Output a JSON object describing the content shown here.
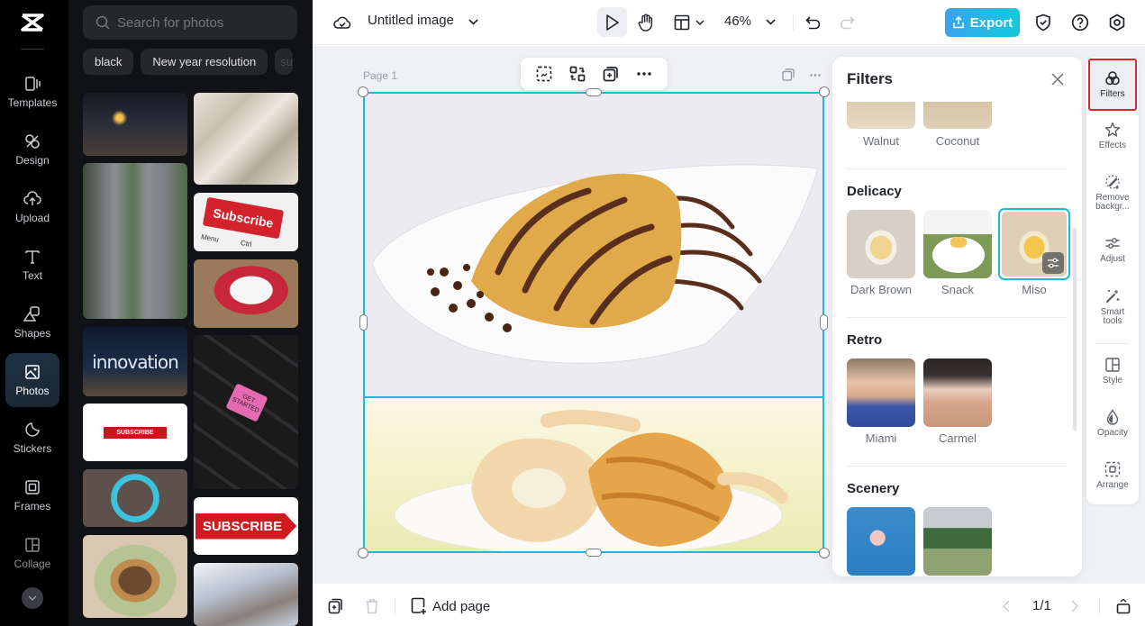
{
  "nav_rail": {
    "items": [
      {
        "label": "Templates",
        "icon": "templates-icon"
      },
      {
        "label": "Design",
        "icon": "design-icon"
      },
      {
        "label": "Upload",
        "icon": "upload-icon"
      },
      {
        "label": "Text",
        "icon": "text-icon"
      },
      {
        "label": "Shapes",
        "icon": "shapes-icon"
      },
      {
        "label": "Photos",
        "icon": "photos-icon",
        "active": true
      },
      {
        "label": "Stickers",
        "icon": "stickers-icon"
      },
      {
        "label": "Frames",
        "icon": "frames-icon"
      },
      {
        "label": "Collage",
        "icon": "collage-icon"
      }
    ]
  },
  "photos_panel": {
    "search_placeholder": "Search for photos",
    "chips": [
      "black",
      "New year resolution",
      "su"
    ],
    "photos": [
      {
        "alt": "City at night"
      },
      {
        "alt": "Satin fabric"
      },
      {
        "alt": "Aerial avenue"
      },
      {
        "alt": "Subscribe key"
      },
      {
        "alt": "Bruschetta"
      },
      {
        "alt": "Innovation"
      },
      {
        "alt": "Calculator get started"
      },
      {
        "alt": "Subscribe banner"
      },
      {
        "alt": "Circle of lights"
      },
      {
        "alt": "Subscribe arrow"
      },
      {
        "alt": "Veggie burger"
      },
      {
        "alt": "Coastal cliffs"
      }
    ],
    "photo_texts": {
      "subscribe_key": "Subscribe",
      "menu": "Menu",
      "ctrl": "Ctrl",
      "innovation": "innovation",
      "get_started": "GET STARTED",
      "subscribe_banner": "SUBSCRIBE",
      "subscribe_arrow": "SUBSCRIBE"
    }
  },
  "topbar": {
    "title": "Untitled image",
    "zoom": "46%",
    "export_label": "Export"
  },
  "canvas": {
    "page_label": "Page 1"
  },
  "bottombar": {
    "add_page_label": "Add page",
    "page_indicator": "1/1"
  },
  "filters_panel": {
    "title": "Filters",
    "sections": [
      {
        "name": "",
        "items": [
          {
            "label": "Walnut"
          },
          {
            "label": "Coconut"
          }
        ]
      },
      {
        "name": "Delicacy",
        "items": [
          {
            "label": "Dark Brown"
          },
          {
            "label": "Snack"
          },
          {
            "label": "Miso",
            "selected": true
          }
        ]
      },
      {
        "name": "Retro",
        "items": [
          {
            "label": "Miami"
          },
          {
            "label": "Carmel"
          }
        ]
      },
      {
        "name": "Scenery",
        "items": [
          {
            "label": ""
          },
          {
            "label": ""
          }
        ]
      }
    ]
  },
  "tool_rail": {
    "items": [
      {
        "label": "Filters",
        "active": true
      },
      {
        "label": "Effects"
      },
      {
        "label": "Remove backgr..."
      },
      {
        "label": "Adjust"
      },
      {
        "label": "Smart tools"
      },
      {
        "label": "Style"
      },
      {
        "label": "Opacity"
      },
      {
        "label": "Arrange"
      }
    ]
  },
  "colors": {
    "accent": "#19bcd7",
    "export_gradient_start": "#3aa4ee",
    "export_gradient_end": "#14c8dc",
    "active_tool_outline": "#e0262e"
  }
}
